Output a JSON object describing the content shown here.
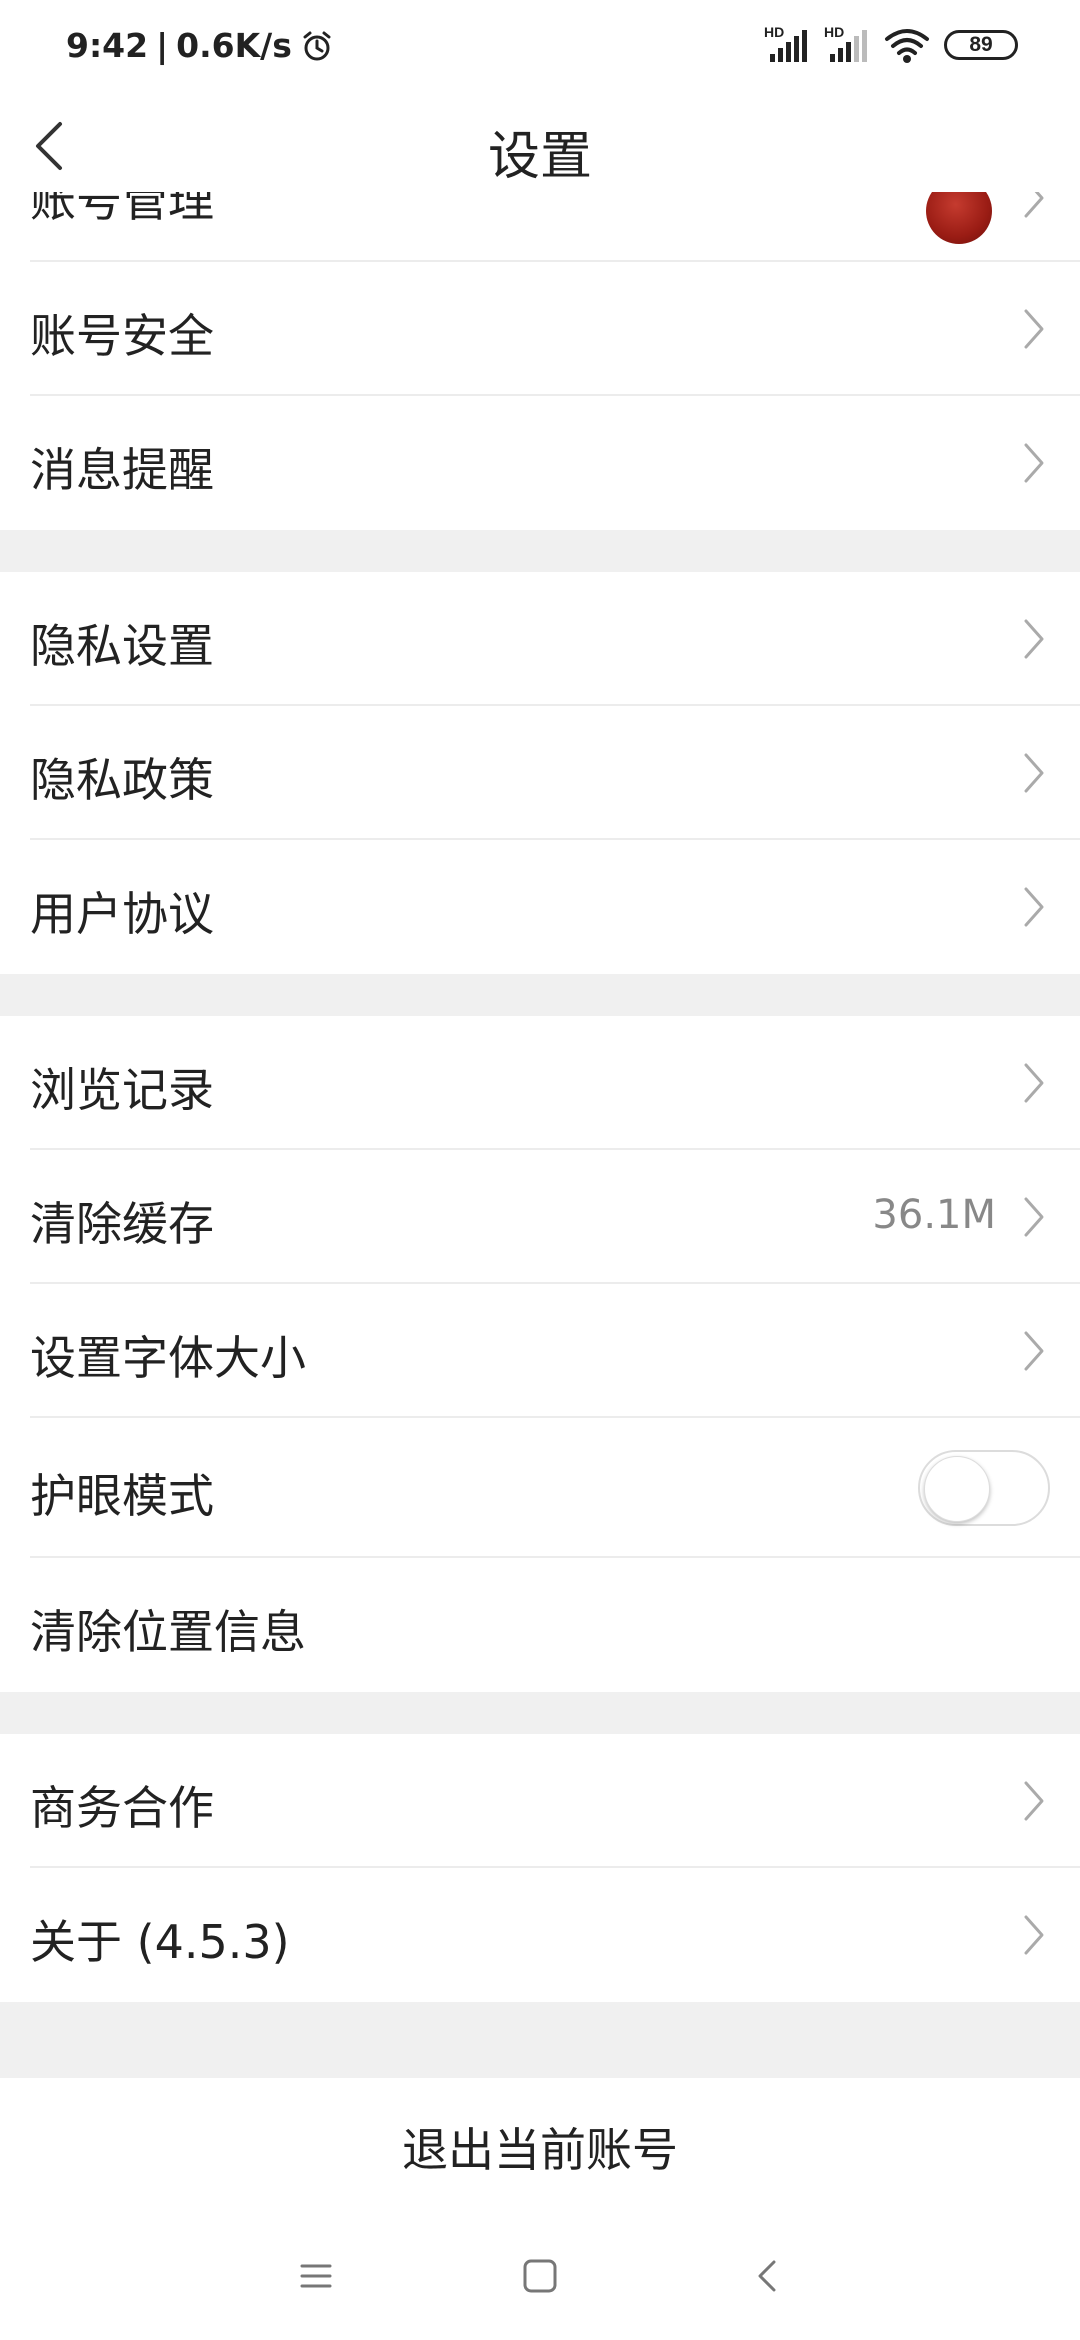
{
  "status_bar": {
    "time": "9:42",
    "separator": "|",
    "speed": "0.6K/s",
    "battery": "89",
    "sim1_label": "HD",
    "sim2_label": "HD"
  },
  "header": {
    "title": "设置"
  },
  "items": {
    "partial": "账号管理",
    "account_security": "账号安全",
    "notifications": "消息提醒",
    "privacy_settings": "隐私设置",
    "privacy_policy": "隐私政策",
    "user_agreement": "用户协议",
    "history": "浏览记录",
    "clear_cache": "清除缓存",
    "clear_cache_value": "36.1M",
    "font_size": "设置字体大小",
    "eye_mode": "护眼模式",
    "eye_mode_enabled": false,
    "clear_location": "清除位置信息",
    "business": "商务合作",
    "about": "关于 (4.5.3)"
  },
  "logout": "退出当前账号",
  "icons": {
    "back": "back-arrow-icon",
    "chevron": "chevron-right-icon",
    "alarm": "alarm-icon",
    "wifi": "wifi-icon",
    "signal": "signal-icon",
    "battery": "battery-icon"
  },
  "colors": {
    "background": "#ffffff",
    "section_gap": "#f0f0f0",
    "text": "#222222",
    "secondary_text": "#888888"
  }
}
